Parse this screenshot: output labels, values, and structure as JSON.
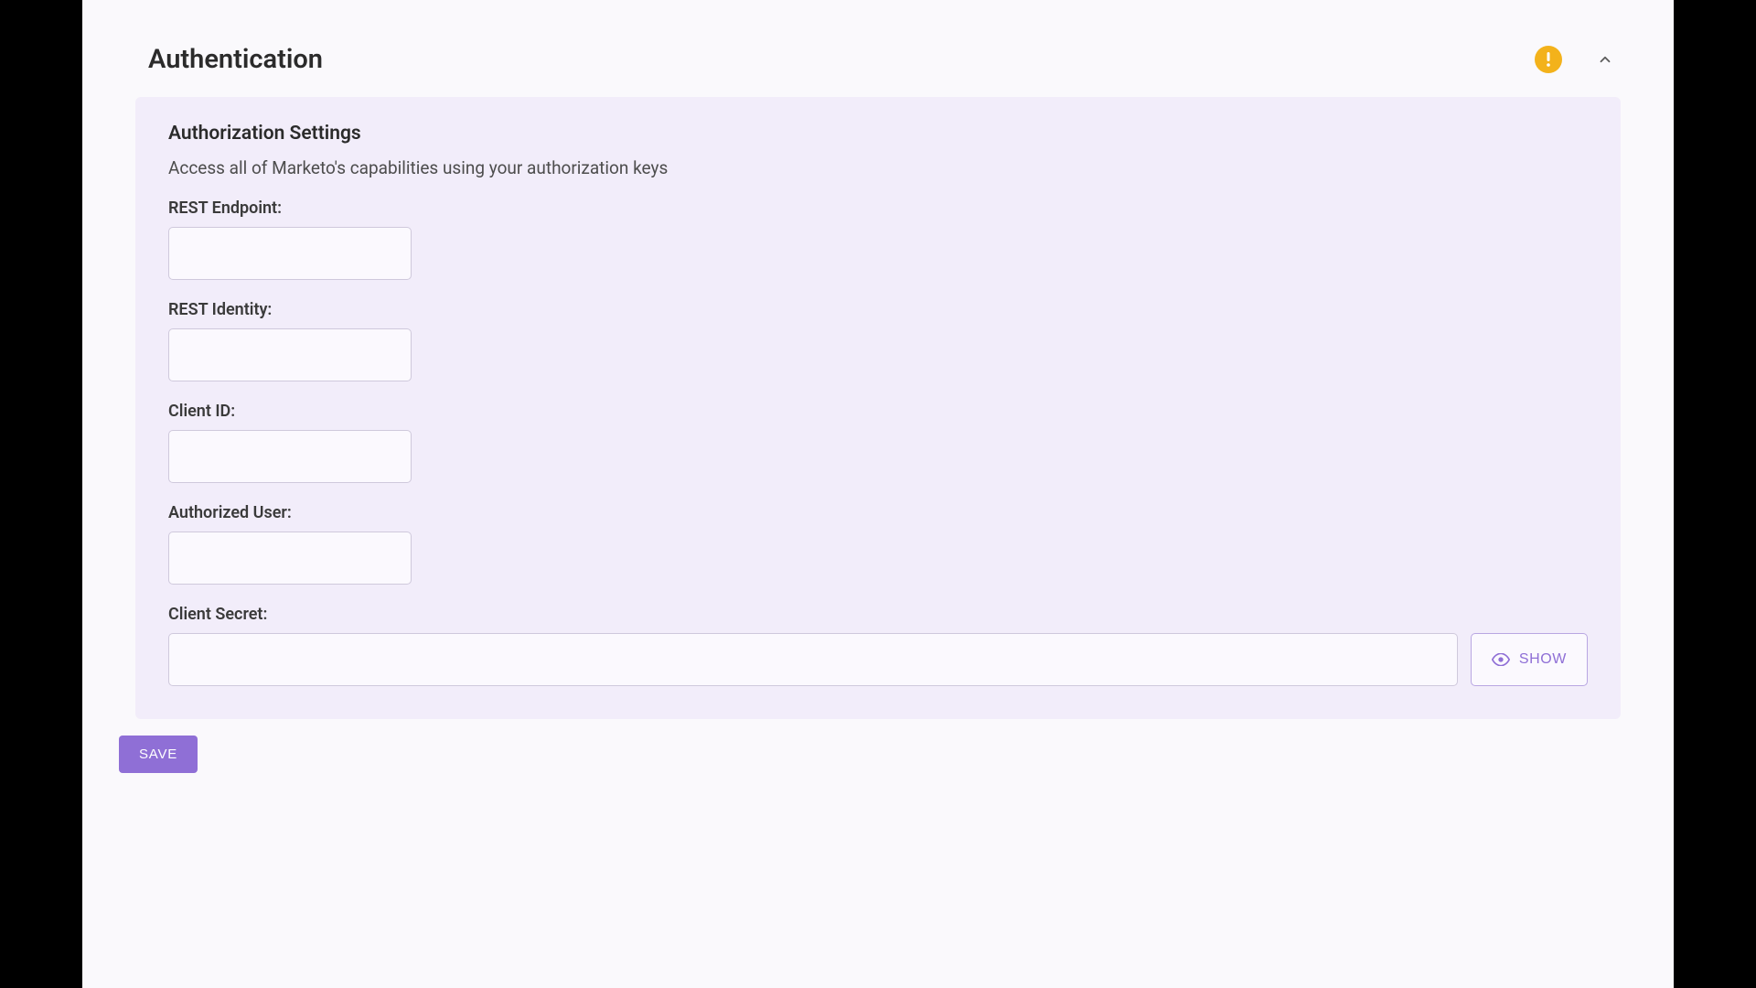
{
  "panel": {
    "title": "Authentication"
  },
  "card": {
    "title": "Authorization Settings",
    "subtitle": "Access all of Marketo's capabilities using your authorization keys"
  },
  "fields": {
    "rest_endpoint": {
      "label": "REST Endpoint:",
      "value": ""
    },
    "rest_identity": {
      "label": "REST Identity:",
      "value": ""
    },
    "client_id": {
      "label": "Client ID:",
      "value": ""
    },
    "authorized_user": {
      "label": "Authorized User:",
      "value": ""
    },
    "client_secret": {
      "label": "Client Secret:",
      "value": ""
    }
  },
  "buttons": {
    "show": "SHOW",
    "save": "SAVE"
  }
}
